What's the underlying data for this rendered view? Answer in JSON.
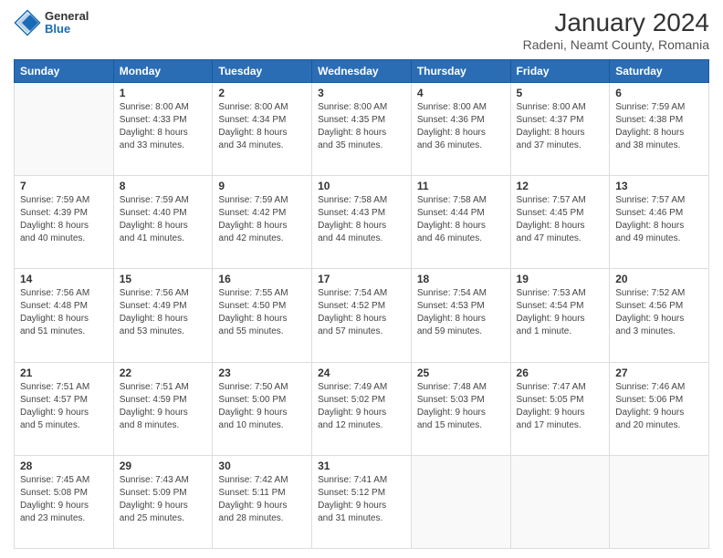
{
  "header": {
    "logo_line1": "General",
    "logo_line2": "Blue",
    "title": "January 2024",
    "subtitle": "Radeni, Neamt County, Romania"
  },
  "calendar": {
    "days_of_week": [
      "Sunday",
      "Monday",
      "Tuesday",
      "Wednesday",
      "Thursday",
      "Friday",
      "Saturday"
    ],
    "weeks": [
      [
        {
          "num": "",
          "info": ""
        },
        {
          "num": "1",
          "info": "Sunrise: 8:00 AM\nSunset: 4:33 PM\nDaylight: 8 hours\nand 33 minutes."
        },
        {
          "num": "2",
          "info": "Sunrise: 8:00 AM\nSunset: 4:34 PM\nDaylight: 8 hours\nand 34 minutes."
        },
        {
          "num": "3",
          "info": "Sunrise: 8:00 AM\nSunset: 4:35 PM\nDaylight: 8 hours\nand 35 minutes."
        },
        {
          "num": "4",
          "info": "Sunrise: 8:00 AM\nSunset: 4:36 PM\nDaylight: 8 hours\nand 36 minutes."
        },
        {
          "num": "5",
          "info": "Sunrise: 8:00 AM\nSunset: 4:37 PM\nDaylight: 8 hours\nand 37 minutes."
        },
        {
          "num": "6",
          "info": "Sunrise: 7:59 AM\nSunset: 4:38 PM\nDaylight: 8 hours\nand 38 minutes."
        }
      ],
      [
        {
          "num": "7",
          "info": "Sunrise: 7:59 AM\nSunset: 4:39 PM\nDaylight: 8 hours\nand 40 minutes."
        },
        {
          "num": "8",
          "info": "Sunrise: 7:59 AM\nSunset: 4:40 PM\nDaylight: 8 hours\nand 41 minutes."
        },
        {
          "num": "9",
          "info": "Sunrise: 7:59 AM\nSunset: 4:42 PM\nDaylight: 8 hours\nand 42 minutes."
        },
        {
          "num": "10",
          "info": "Sunrise: 7:58 AM\nSunset: 4:43 PM\nDaylight: 8 hours\nand 44 minutes."
        },
        {
          "num": "11",
          "info": "Sunrise: 7:58 AM\nSunset: 4:44 PM\nDaylight: 8 hours\nand 46 minutes."
        },
        {
          "num": "12",
          "info": "Sunrise: 7:57 AM\nSunset: 4:45 PM\nDaylight: 8 hours\nand 47 minutes."
        },
        {
          "num": "13",
          "info": "Sunrise: 7:57 AM\nSunset: 4:46 PM\nDaylight: 8 hours\nand 49 minutes."
        }
      ],
      [
        {
          "num": "14",
          "info": "Sunrise: 7:56 AM\nSunset: 4:48 PM\nDaylight: 8 hours\nand 51 minutes."
        },
        {
          "num": "15",
          "info": "Sunrise: 7:56 AM\nSunset: 4:49 PM\nDaylight: 8 hours\nand 53 minutes."
        },
        {
          "num": "16",
          "info": "Sunrise: 7:55 AM\nSunset: 4:50 PM\nDaylight: 8 hours\nand 55 minutes."
        },
        {
          "num": "17",
          "info": "Sunrise: 7:54 AM\nSunset: 4:52 PM\nDaylight: 8 hours\nand 57 minutes."
        },
        {
          "num": "18",
          "info": "Sunrise: 7:54 AM\nSunset: 4:53 PM\nDaylight: 8 hours\nand 59 minutes."
        },
        {
          "num": "19",
          "info": "Sunrise: 7:53 AM\nSunset: 4:54 PM\nDaylight: 9 hours\nand 1 minute."
        },
        {
          "num": "20",
          "info": "Sunrise: 7:52 AM\nSunset: 4:56 PM\nDaylight: 9 hours\nand 3 minutes."
        }
      ],
      [
        {
          "num": "21",
          "info": "Sunrise: 7:51 AM\nSunset: 4:57 PM\nDaylight: 9 hours\nand 5 minutes."
        },
        {
          "num": "22",
          "info": "Sunrise: 7:51 AM\nSunset: 4:59 PM\nDaylight: 9 hours\nand 8 minutes."
        },
        {
          "num": "23",
          "info": "Sunrise: 7:50 AM\nSunset: 5:00 PM\nDaylight: 9 hours\nand 10 minutes."
        },
        {
          "num": "24",
          "info": "Sunrise: 7:49 AM\nSunset: 5:02 PM\nDaylight: 9 hours\nand 12 minutes."
        },
        {
          "num": "25",
          "info": "Sunrise: 7:48 AM\nSunset: 5:03 PM\nDaylight: 9 hours\nand 15 minutes."
        },
        {
          "num": "26",
          "info": "Sunrise: 7:47 AM\nSunset: 5:05 PM\nDaylight: 9 hours\nand 17 minutes."
        },
        {
          "num": "27",
          "info": "Sunrise: 7:46 AM\nSunset: 5:06 PM\nDaylight: 9 hours\nand 20 minutes."
        }
      ],
      [
        {
          "num": "28",
          "info": "Sunrise: 7:45 AM\nSunset: 5:08 PM\nDaylight: 9 hours\nand 23 minutes."
        },
        {
          "num": "29",
          "info": "Sunrise: 7:43 AM\nSunset: 5:09 PM\nDaylight: 9 hours\nand 25 minutes."
        },
        {
          "num": "30",
          "info": "Sunrise: 7:42 AM\nSunset: 5:11 PM\nDaylight: 9 hours\nand 28 minutes."
        },
        {
          "num": "31",
          "info": "Sunrise: 7:41 AM\nSunset: 5:12 PM\nDaylight: 9 hours\nand 31 minutes."
        },
        {
          "num": "",
          "info": ""
        },
        {
          "num": "",
          "info": ""
        },
        {
          "num": "",
          "info": ""
        }
      ]
    ]
  }
}
